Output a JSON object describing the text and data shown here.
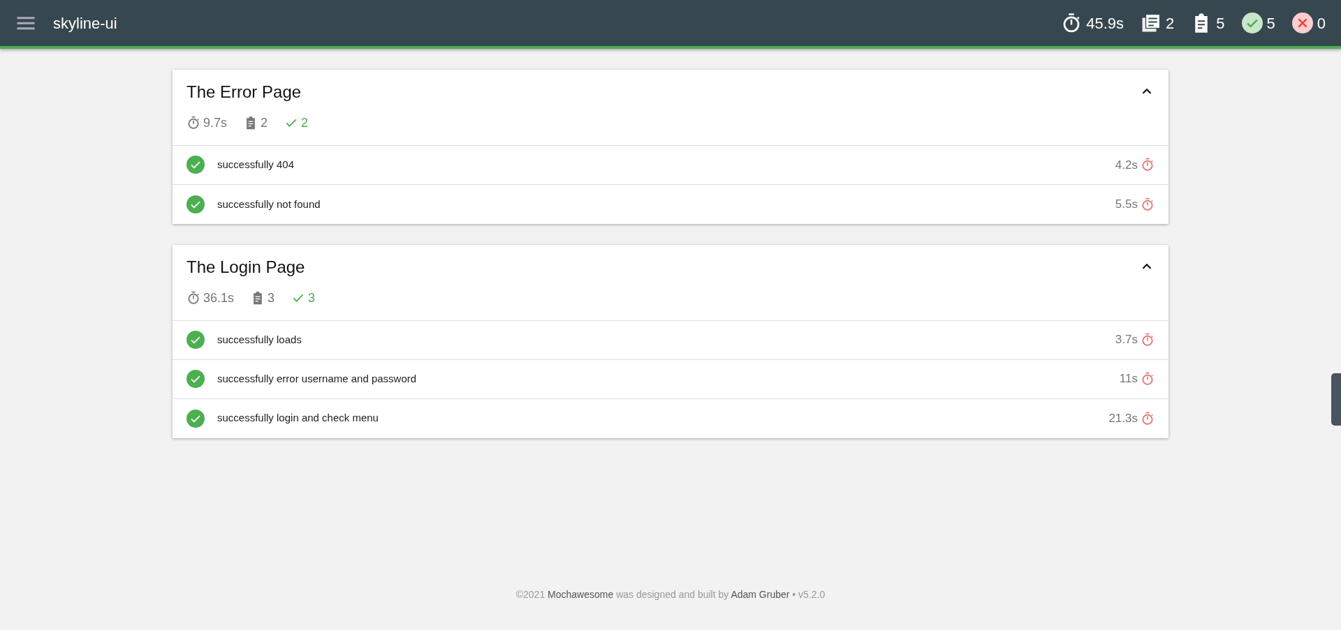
{
  "navbar": {
    "title": "skyline-ui",
    "stats": [
      {
        "kind": "duration",
        "value": "45.9s"
      },
      {
        "kind": "suites",
        "value": "2"
      },
      {
        "kind": "tests",
        "value": "5"
      },
      {
        "kind": "passes",
        "value": "5"
      },
      {
        "kind": "failures",
        "value": "0"
      }
    ]
  },
  "suites": [
    {
      "title": "The Error Page",
      "expanded": true,
      "stats": {
        "duration": "9.7s",
        "tests": "2",
        "passes": "2"
      },
      "tests": [
        {
          "title": "successfully 404",
          "passed": true,
          "duration": "4.2s"
        },
        {
          "title": "successfully not found",
          "passed": true,
          "duration": "5.5s"
        }
      ]
    },
    {
      "title": "The Login Page",
      "expanded": true,
      "stats": {
        "duration": "36.1s",
        "tests": "3",
        "passes": "3"
      },
      "tests": [
        {
          "title": "successfully loads",
          "passed": true,
          "duration": "3.7s"
        },
        {
          "title": "successfully error username and password",
          "passed": true,
          "duration": "11s"
        },
        {
          "title": "successfully login and check menu",
          "passed": true,
          "duration": "21.3s"
        }
      ]
    }
  ],
  "footer": {
    "year": "©2021",
    "product": "Mochawesome",
    "middle": "was designed and built by",
    "author": "Adam Gruber",
    "version": "• v5.2.0"
  }
}
